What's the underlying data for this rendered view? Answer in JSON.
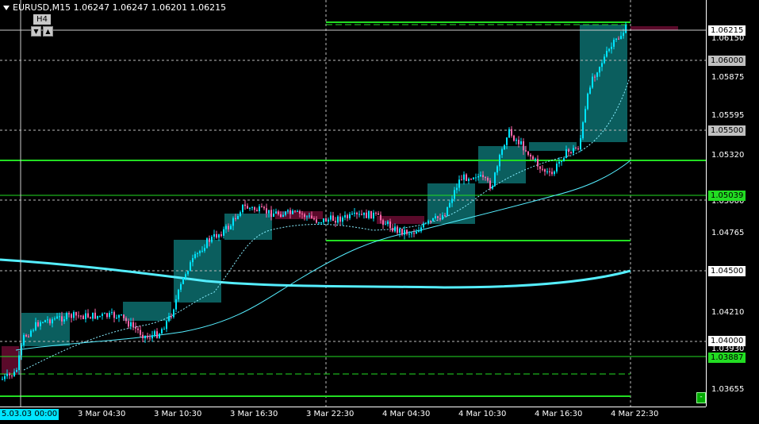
{
  "header": {
    "symbol_timeframe": "EURUSD,M15",
    "open": "1.06247",
    "high": "1.06247",
    "low": "1.06201",
    "close": "1.06215"
  },
  "timeframe_widget": {
    "label": "H4",
    "down_icon": "triangle-down-icon",
    "up_icon": "triangle-up-icon"
  },
  "price_axis": {
    "labels": [
      "1.06150",
      "1.05875",
      "1.05595",
      "1.05320",
      "1.05000",
      "1.04765",
      "1.04210",
      "1.03930",
      "1.03655"
    ],
    "current_price": "1.06215",
    "level_boxes": [
      {
        "text": "1.06000",
        "bg": "#c0c0c0",
        "fg": "#000000"
      },
      {
        "text": "1.05500",
        "bg": "#c0c0c0",
        "fg": "#000000"
      },
      {
        "text": "1.05039",
        "bg": "#22dd22",
        "fg": "#000000"
      },
      {
        "text": "1.04500",
        "bg": "#ffffff",
        "fg": "#000000"
      },
      {
        "text": "1.04000",
        "bg": "#ffffff",
        "fg": "#000000"
      },
      {
        "text": "1.03887",
        "bg": "#22dd22",
        "fg": "#000000"
      }
    ]
  },
  "time_axis": {
    "first_label": "5.03.03 00:00",
    "labels": [
      "3 Mar 04:30",
      "3 Mar 10:30",
      "3 Mar 16:30",
      "3 Mar 22:30",
      "4 Mar 04:30",
      "4 Mar 10:30",
      "4 Mar 16:30",
      "4 Mar 22:30"
    ]
  },
  "corner_button": "-",
  "colors": {
    "background": "#000000",
    "bull_candle": "#00e5ff",
    "bear_candle": "#ff66aa",
    "h4_bull_box": "#0b5e5e",
    "h4_bear_box": "#5a0a2a",
    "level_green": "#22dd22",
    "ma_color": "#55eeff"
  }
}
